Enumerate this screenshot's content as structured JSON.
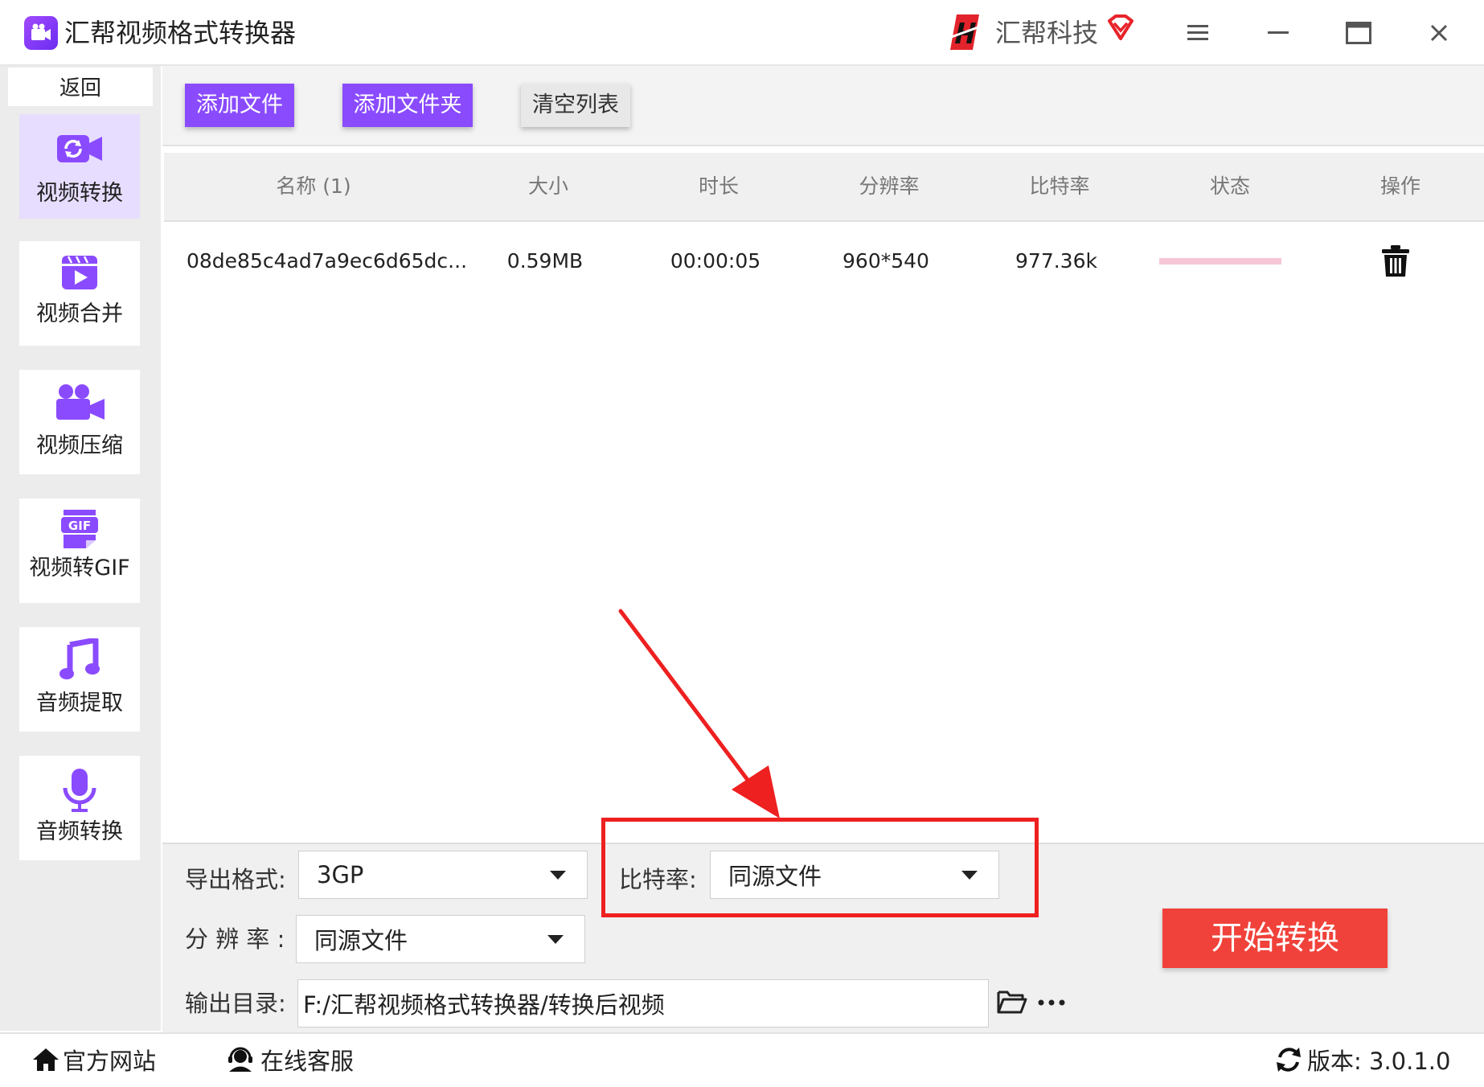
{
  "window": {
    "title": "汇帮视频格式转换器",
    "brand": "汇帮科技"
  },
  "sidebar": {
    "back_label": "返回",
    "items": [
      {
        "label": "视频转换",
        "icon": "video-convert-icon",
        "active": true
      },
      {
        "label": "视频合并",
        "icon": "video-merge-icon",
        "active": false
      },
      {
        "label": "视频压缩",
        "icon": "video-compress-icon",
        "active": false
      },
      {
        "label": "视频转GIF",
        "icon": "gif-icon",
        "active": false
      },
      {
        "label": "音频提取",
        "icon": "music-note-icon",
        "active": false
      },
      {
        "label": "音频转换",
        "icon": "microphone-icon",
        "active": false
      }
    ]
  },
  "toolbar": {
    "add_file": "添加文件",
    "add_folder": "添加文件夹",
    "clear_list": "清空列表"
  },
  "table": {
    "columns": [
      "名称 (1)",
      "大小",
      "时长",
      "分辨率",
      "比特率",
      "状态",
      "操作"
    ],
    "rows": [
      {
        "name": "08de85c4ad7a9ec6d65dc...",
        "size": "0.59MB",
        "duration": "00:00:05",
        "resolution": "960*540",
        "bitrate": "977.36k",
        "status_progress": 0,
        "action_icon": "trash-icon"
      }
    ]
  },
  "settings": {
    "format_label": "导出格式:",
    "format_value": "3GP",
    "bitrate_label": "比特率:",
    "bitrate_value": "同源文件",
    "resolution_label": "分 辨 率 :",
    "resolution_value": "同源文件",
    "output_label": "输出目录:",
    "output_value": "F:/汇帮视频格式转换器/转换后视频",
    "start_button": "开始转换"
  },
  "footer": {
    "website": "官方网站",
    "support": "在线客服",
    "version": "版本: 3.0.1.0"
  },
  "colors": {
    "accent_purple": "#8a4bff",
    "start_red": "#f0423a",
    "highlight_red": "#ee2020",
    "progress_pink": "#f5c6d6"
  }
}
